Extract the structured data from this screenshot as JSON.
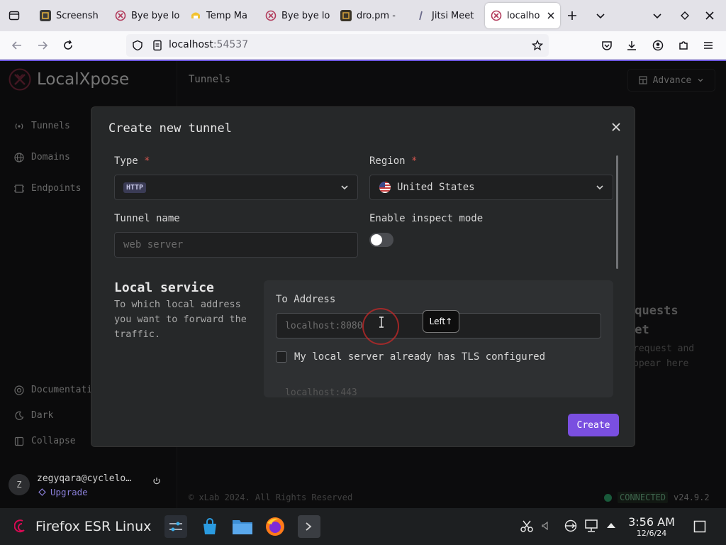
{
  "browser": {
    "tabs": [
      {
        "label": "Screensh",
        "favicon": "screenshot-icon"
      },
      {
        "label": "Bye bye lo",
        "favicon": "localxpose-icon"
      },
      {
        "label": "Temp Ma",
        "favicon": "tempmail-icon"
      },
      {
        "label": "Bye bye lo",
        "favicon": "localxpose-icon"
      },
      {
        "label": "dro.pm - ",
        "favicon": "dropm-icon"
      },
      {
        "label": "Jitsi Meet",
        "favicon": "jitsi-icon"
      },
      {
        "label": "localho",
        "favicon": "localxpose-icon",
        "active": true
      }
    ],
    "url_host": "localhost",
    "url_port": ":54537"
  },
  "app": {
    "brand": "LocalXpose",
    "header_title": "Tunnels",
    "advance_label": "Advance",
    "sidebar": {
      "items": [
        {
          "label": "Tunnels",
          "icon": "broadcast-icon"
        },
        {
          "label": "Domains",
          "icon": "globe-icon"
        },
        {
          "label": "Endpoints",
          "icon": "endpoints-icon"
        }
      ],
      "bottom_items": [
        {
          "label": "Documentati",
          "icon": "lifebuoy-icon"
        },
        {
          "label": "Dark",
          "icon": "moon-icon"
        },
        {
          "label": "Collapse",
          "icon": "collapse-icon"
        }
      ]
    },
    "background_text": {
      "title_line1": "equests",
      "title_line2": "yet",
      "sub_line1": "request and",
      "sub_line2": "ppear here"
    },
    "footer": "© xLab 2024. All Rights Reserved",
    "connection_status": "CONNECTED",
    "version": "v24.9.2",
    "user": {
      "avatar_letter": "Z",
      "email": "zegyqara@cyclelo…",
      "upgrade_label": "Upgrade"
    }
  },
  "modal": {
    "title": "Create new tunnel",
    "type_label": "Type",
    "type_value": "HTTP",
    "region_label": "Region",
    "region_value": "United States",
    "tunnel_name_label": "Tunnel name",
    "tunnel_name_placeholder": "web server",
    "inspect_label": "Enable inspect mode",
    "inspect_enabled": false,
    "local_service_title": "Local service",
    "local_service_desc": "To which local address you want to forward the traffic.",
    "to_address_label": "To Address",
    "to_address_placeholder": "localhost:8080",
    "tls_label": "My local server already has TLS configured",
    "tls_checked": false,
    "faded_text": "localhost:443",
    "create_label": "Create",
    "required_mark": "*"
  },
  "overlay": {
    "key_tooltip": "Left↑"
  },
  "taskbar": {
    "app_title": "Firefox ESR Linux",
    "time": "3:56 AM",
    "date": "12/6/24"
  },
  "colors": {
    "accent": "#7a4fe0",
    "required": "#d4564f",
    "connected": "#2ea36a",
    "browser_accent": "#6d57e0"
  }
}
